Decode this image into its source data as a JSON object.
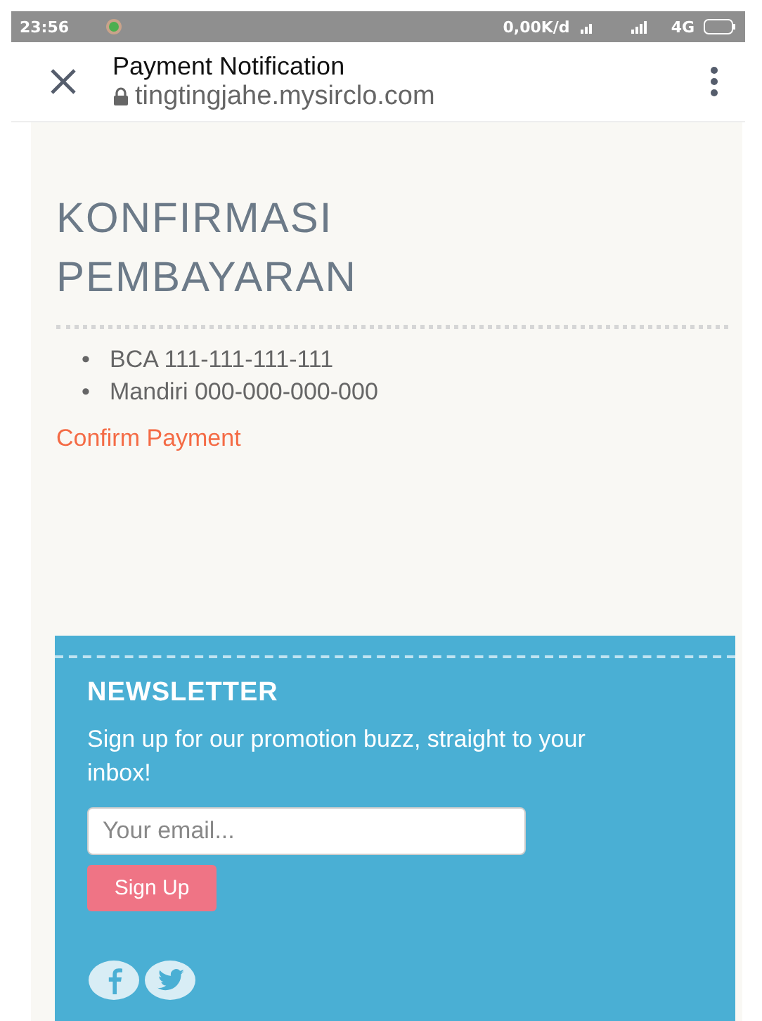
{
  "status_bar": {
    "time": "23:56",
    "speed": "0,00K/d",
    "network": "4G"
  },
  "header": {
    "title": "Payment Notification",
    "url": "tingtingjahe.mysirclo.com"
  },
  "page": {
    "heading_lines": [
      "KONFIRMASI",
      "PEMBAYARAN"
    ],
    "accounts": [
      "BCA 111-111-111-111",
      "Mandiri 000-000-000-000"
    ],
    "bullet": "•",
    "link": "Confirm Payment"
  },
  "newsletter": {
    "title": "NEWSLETTER",
    "text": "Sign up for our promotion buzz, straight to your inbox!",
    "placeholder": "Your email...",
    "button": "Sign Up",
    "social": [
      {
        "kind": "facebook"
      },
      {
        "kind": "twitter"
      }
    ]
  }
}
